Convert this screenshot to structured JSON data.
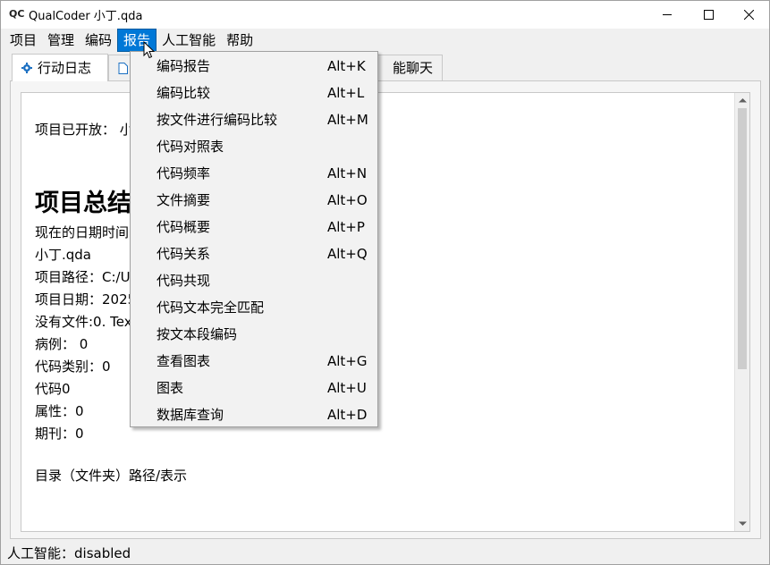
{
  "window": {
    "title": "QualCoder 小丁.qda",
    "icon_text": "QC"
  },
  "menubar": [
    {
      "label": "项目"
    },
    {
      "label": "管理"
    },
    {
      "label": "编码"
    },
    {
      "label": "报告"
    },
    {
      "label": "人工智能"
    },
    {
      "label": "帮助"
    }
  ],
  "tabs": {
    "tab1": {
      "label": "行动日志",
      "icon": "gear-icon"
    },
    "tab2": {
      "icon": "document-icon"
    },
    "tab3": {
      "label": "能聊天"
    }
  },
  "log": {
    "project_opened": "项目已开放： 小丁",
    "heading": "项目总结",
    "lines": [
      "现在的日期时间：",
      "小丁.qda",
      "项目路径：C:/Us",
      "项目日期：2025-",
      "没有文件:0. Text",
      "病例： 0",
      "代码类别：0",
      "代码0",
      "属性：0",
      "期刊：0"
    ],
    "directory": "目录（文件夹）路径/表示"
  },
  "report_menu": {
    "items": [
      {
        "label": "编码报告",
        "shortcut": "Alt+K"
      },
      {
        "label": "编码比较",
        "shortcut": "Alt+L"
      },
      {
        "label": "按文件进行编码比较",
        "shortcut": "Alt+M"
      },
      {
        "label": "代码对照表",
        "shortcut": ""
      },
      {
        "label": "代码频率",
        "shortcut": "Alt+N"
      },
      {
        "label": "文件摘要",
        "shortcut": "Alt+O"
      },
      {
        "label": "代码概要",
        "shortcut": "Alt+P"
      },
      {
        "label": "代码关系",
        "shortcut": "Alt+Q"
      },
      {
        "label": "代码共现",
        "shortcut": ""
      },
      {
        "label": "代码文本完全匹配",
        "shortcut": ""
      },
      {
        "label": "按文本段编码",
        "shortcut": ""
      },
      {
        "label": "查看图表",
        "shortcut": "Alt+G"
      },
      {
        "label": "图表",
        "shortcut": "Alt+U"
      },
      {
        "label": "数据库查询",
        "shortcut": "Alt+D"
      }
    ]
  },
  "statusbar": {
    "text": "人工智能：disabled"
  },
  "colors": {
    "accent": "#0078d7",
    "menu_bg": "#f2f2f2",
    "window_bg": "#f0f0f0"
  }
}
